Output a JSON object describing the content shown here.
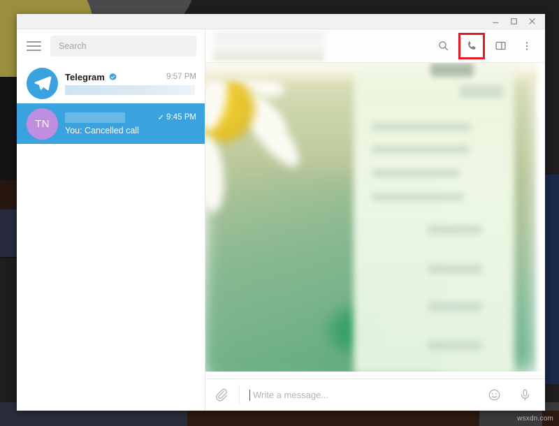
{
  "desktop": {
    "watermark": "wsxdn.com"
  },
  "window": {
    "controls": {
      "minimize": "minimize-button",
      "maximize": "maximize-button",
      "close": "close-button"
    }
  },
  "sidebar": {
    "menu_icon": "hamburger-menu-icon",
    "search": {
      "placeholder": "Search",
      "value": ""
    },
    "chats": [
      {
        "avatar_type": "telegram-logo",
        "avatar_initials": "",
        "title": "Telegram",
        "verified": true,
        "time": "9:57 PM",
        "preview": "",
        "preview_redacted": true,
        "title_redacted": false,
        "read_tick": false,
        "selected": false
      },
      {
        "avatar_type": "initials",
        "avatar_initials": "TN",
        "title": "",
        "verified": false,
        "time": "9:45 PM",
        "preview": "You: Cancelled call",
        "preview_redacted": false,
        "title_redacted": true,
        "read_tick": true,
        "tick_glyph": "✓",
        "selected": true
      }
    ]
  },
  "chat": {
    "header": {
      "title_redacted": true,
      "actions": [
        {
          "name": "search-icon",
          "label": "Search",
          "highlighted": false
        },
        {
          "name": "call-icon",
          "label": "Call",
          "highlighted": true
        },
        {
          "name": "panel-icon",
          "label": "Toggle info panel",
          "highlighted": false
        },
        {
          "name": "more-menu-icon",
          "label": "More",
          "highlighted": false
        }
      ],
      "highlight_color": "#e31c23"
    },
    "body": {
      "content_blurred": true,
      "wallpaper": "blurred-daisy-photo"
    },
    "composer": {
      "attach_icon": "paperclip-icon",
      "placeholder": "Write a message...",
      "value": "",
      "emoji_icon": "emoji-icon",
      "mic_icon": "microphone-icon"
    }
  },
  "colors": {
    "accent": "#3aa2de",
    "highlight": "#e31c23",
    "avatar_purple": "#c08ee0",
    "window_bg": "#ffffff"
  }
}
